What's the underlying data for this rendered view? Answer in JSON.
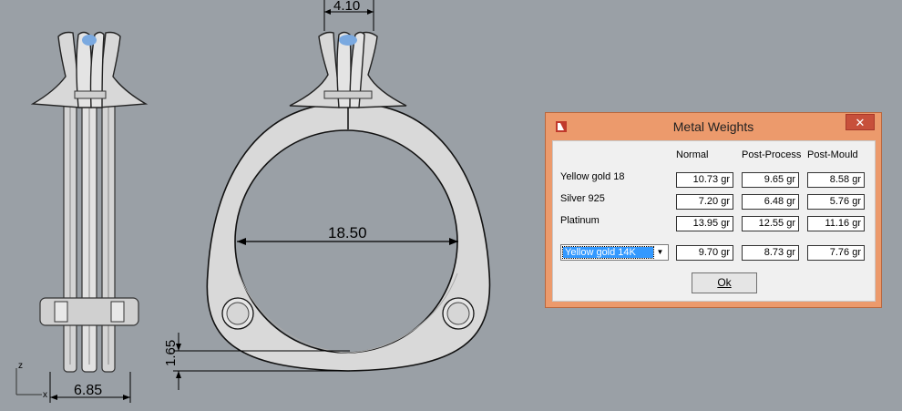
{
  "drawing": {
    "dim_top": "4.10",
    "dim_inner": "18.50",
    "dim_height": "1.65",
    "dim_width": "6.85",
    "axis_z": "z",
    "axis_x": "x"
  },
  "dialog": {
    "title": "Metal Weights",
    "close_label": "✕",
    "columns": [
      "Normal",
      "Post-Process",
      "Post-Mould"
    ],
    "rows": [
      {
        "label": "Yellow gold 18",
        "values": [
          "10.73 gr",
          "9.65 gr",
          "8.58 gr"
        ]
      },
      {
        "label": "Silver 925",
        "values": [
          "7.20 gr",
          "6.48 gr",
          "5.76 gr"
        ]
      },
      {
        "label": "Platinum",
        "values": [
          "13.95 gr",
          "12.55 gr",
          "11.16 gr"
        ]
      }
    ],
    "custom_row": {
      "selected": "Yellow gold 14K",
      "values": [
        "9.70 gr",
        "8.73 gr",
        "7.76 gr"
      ]
    },
    "ok_label": "Ok",
    "colors": {
      "titlebar": "#ec9a6c",
      "close": "#c7503b",
      "selection": "#3399ff"
    }
  }
}
